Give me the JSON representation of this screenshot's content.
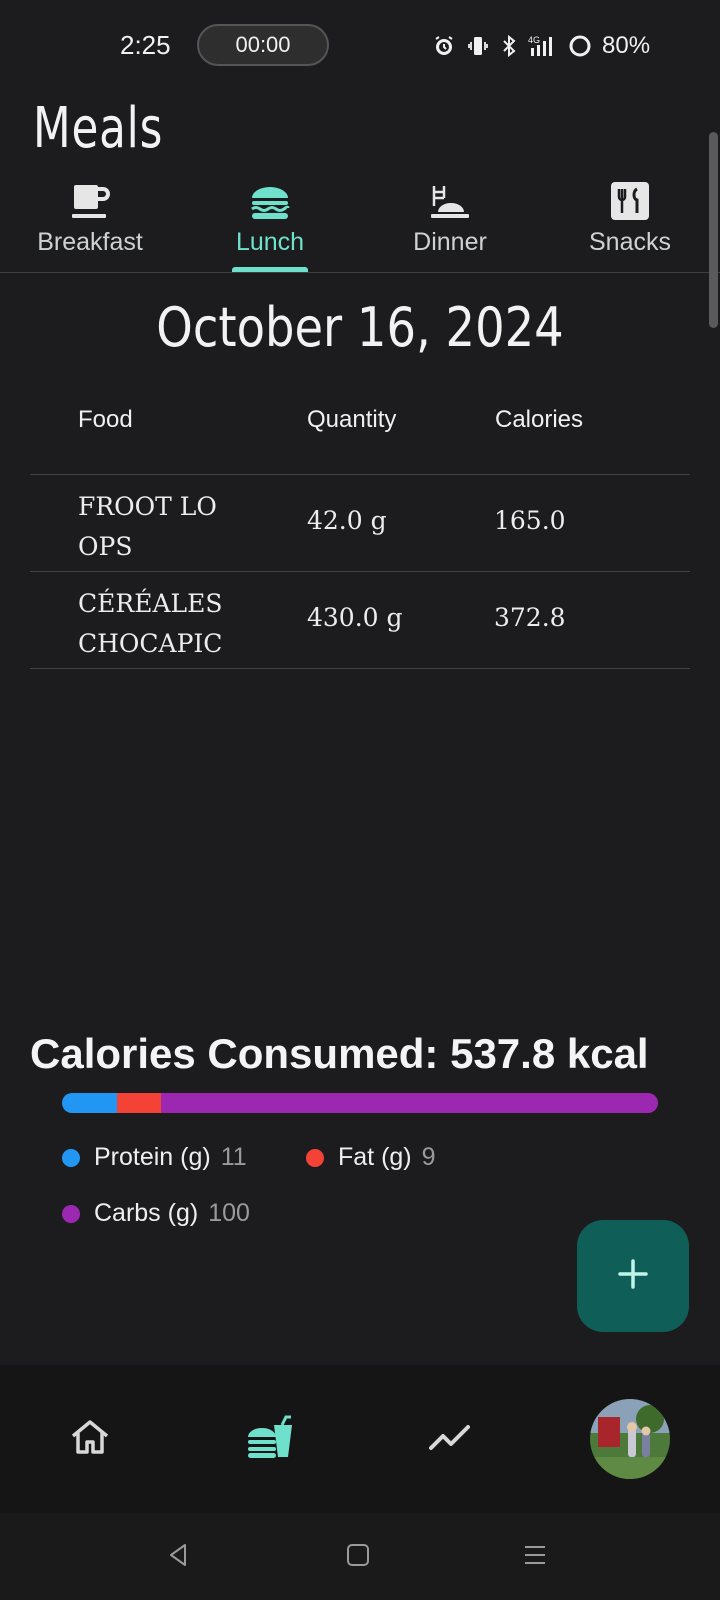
{
  "status_bar": {
    "time": "2:25",
    "timer": "00:00",
    "battery": "80%"
  },
  "page": {
    "title": "Meals"
  },
  "tabs": [
    {
      "label": "Breakfast",
      "icon": "cup-icon",
      "active": false
    },
    {
      "label": "Lunch",
      "icon": "burger-icon",
      "active": true
    },
    {
      "label": "Dinner",
      "icon": "dinner-icon",
      "active": false
    },
    {
      "label": "Snacks",
      "icon": "utensils-icon",
      "active": false
    }
  ],
  "date": "October 16, 2024",
  "table": {
    "headers": {
      "food": "Food",
      "quantity": "Quantity",
      "calories": "Calories"
    },
    "rows": [
      {
        "food": "FROOT LOOPS",
        "quantity": "42.0 g",
        "calories": "165.0"
      },
      {
        "food": "CÉRÉALES CHOCAPIC",
        "quantity": "430.0 g",
        "calories": "372.8"
      }
    ]
  },
  "summary": {
    "title": "Calories Consumed: 537.8 kcal",
    "macros": [
      {
        "label": "Protein (g)",
        "value": "11",
        "color": "#2196f3"
      },
      {
        "label": "Fat (g)",
        "value": "9",
        "color": "#f44336"
      },
      {
        "label": "Carbs (g)",
        "value": "100",
        "color": "#9c27b0"
      }
    ]
  },
  "colors": {
    "accent": "#6fe0cc",
    "fab": "#0f5e57",
    "background": "#1c1c1e"
  },
  "fab": {
    "icon": "plus-icon"
  },
  "bottom_nav": [
    {
      "icon": "home-icon"
    },
    {
      "icon": "meals-icon",
      "active": true
    },
    {
      "icon": "trends-icon"
    },
    {
      "icon": "profile-avatar"
    }
  ]
}
